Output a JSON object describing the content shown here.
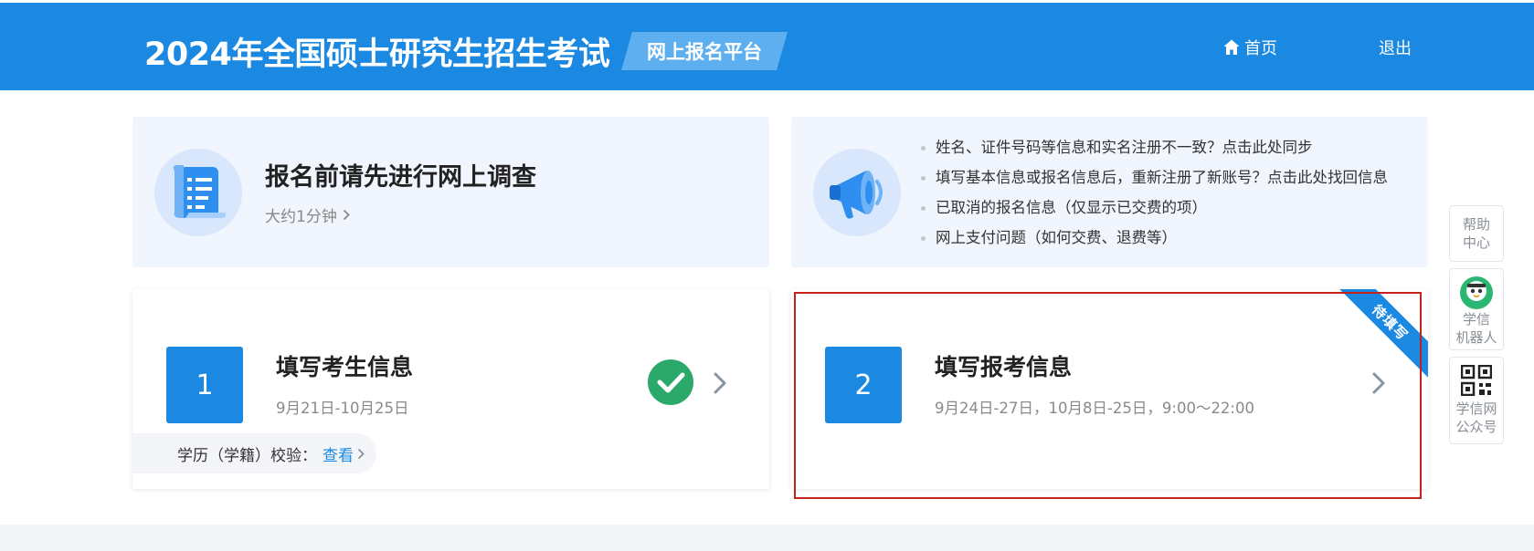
{
  "header": {
    "title": "2024年全国硕士研究生招生考试",
    "platform_badge": "网上报名平台",
    "home_label": "首页",
    "logout_label": "退出"
  },
  "survey_card": {
    "title": "报名前请先进行网上调查",
    "subtitle": "大约1分钟"
  },
  "notice_card": {
    "items": [
      "姓名、证件号码等信息和实名注册不一致？点击此处同步",
      "填写基本信息或报名信息后，重新注册了新账号？点击此处找回信息",
      "已取消的报名信息（仅显示已交费的项）",
      "网上支付问题（如何交费、退费等）"
    ]
  },
  "steps": [
    {
      "number": "1",
      "title": "填写考生信息",
      "dates": "9月21日-10月25日",
      "completed": true,
      "verify_label": "学历（学籍）校验：",
      "verify_link": "查看"
    },
    {
      "number": "2",
      "title": "填写报考信息",
      "dates": "9月24日-27日，10月8日-25日，9:00～22:00",
      "ribbon": "待填写"
    }
  ],
  "side_widgets": {
    "help_line1": "帮助",
    "help_line2": "中心",
    "robot_line1": "学信",
    "robot_line2": "机器人",
    "wechat_line1": "学信网",
    "wechat_line2": "公众号"
  },
  "colors": {
    "primary": "#1b89e1",
    "success": "#2ba96b",
    "card_bg": "#f1f5fd",
    "highlight": "#c4231c"
  }
}
